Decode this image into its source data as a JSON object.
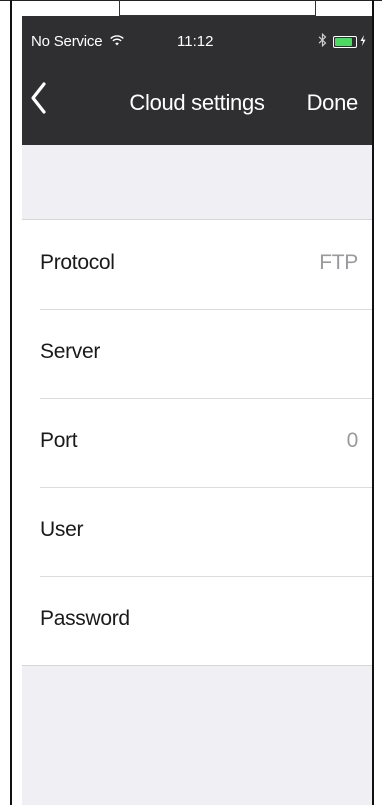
{
  "status_bar": {
    "carrier": "No Service",
    "wifi_icon": "wifi-icon",
    "time": "11:12",
    "bluetooth_icon": "bluetooth-icon",
    "battery_level": 0.85,
    "battery_color": "#4cd964",
    "charge_icon": "charging-bolt-icon"
  },
  "nav": {
    "back_icon": "chevron-left-icon",
    "title": "Cloud settings",
    "done_label": "Done"
  },
  "settings": {
    "rows": [
      {
        "label": "Protocol",
        "value": "FTP"
      },
      {
        "label": "Server",
        "value": ""
      },
      {
        "label": "Port",
        "value": "0"
      },
      {
        "label": "User",
        "value": ""
      },
      {
        "label": "Password",
        "value": ""
      }
    ]
  },
  "colors": {
    "nav_background": "#2f2e31",
    "page_background": "#efeff4",
    "value_text": "#9a9a9e"
  }
}
